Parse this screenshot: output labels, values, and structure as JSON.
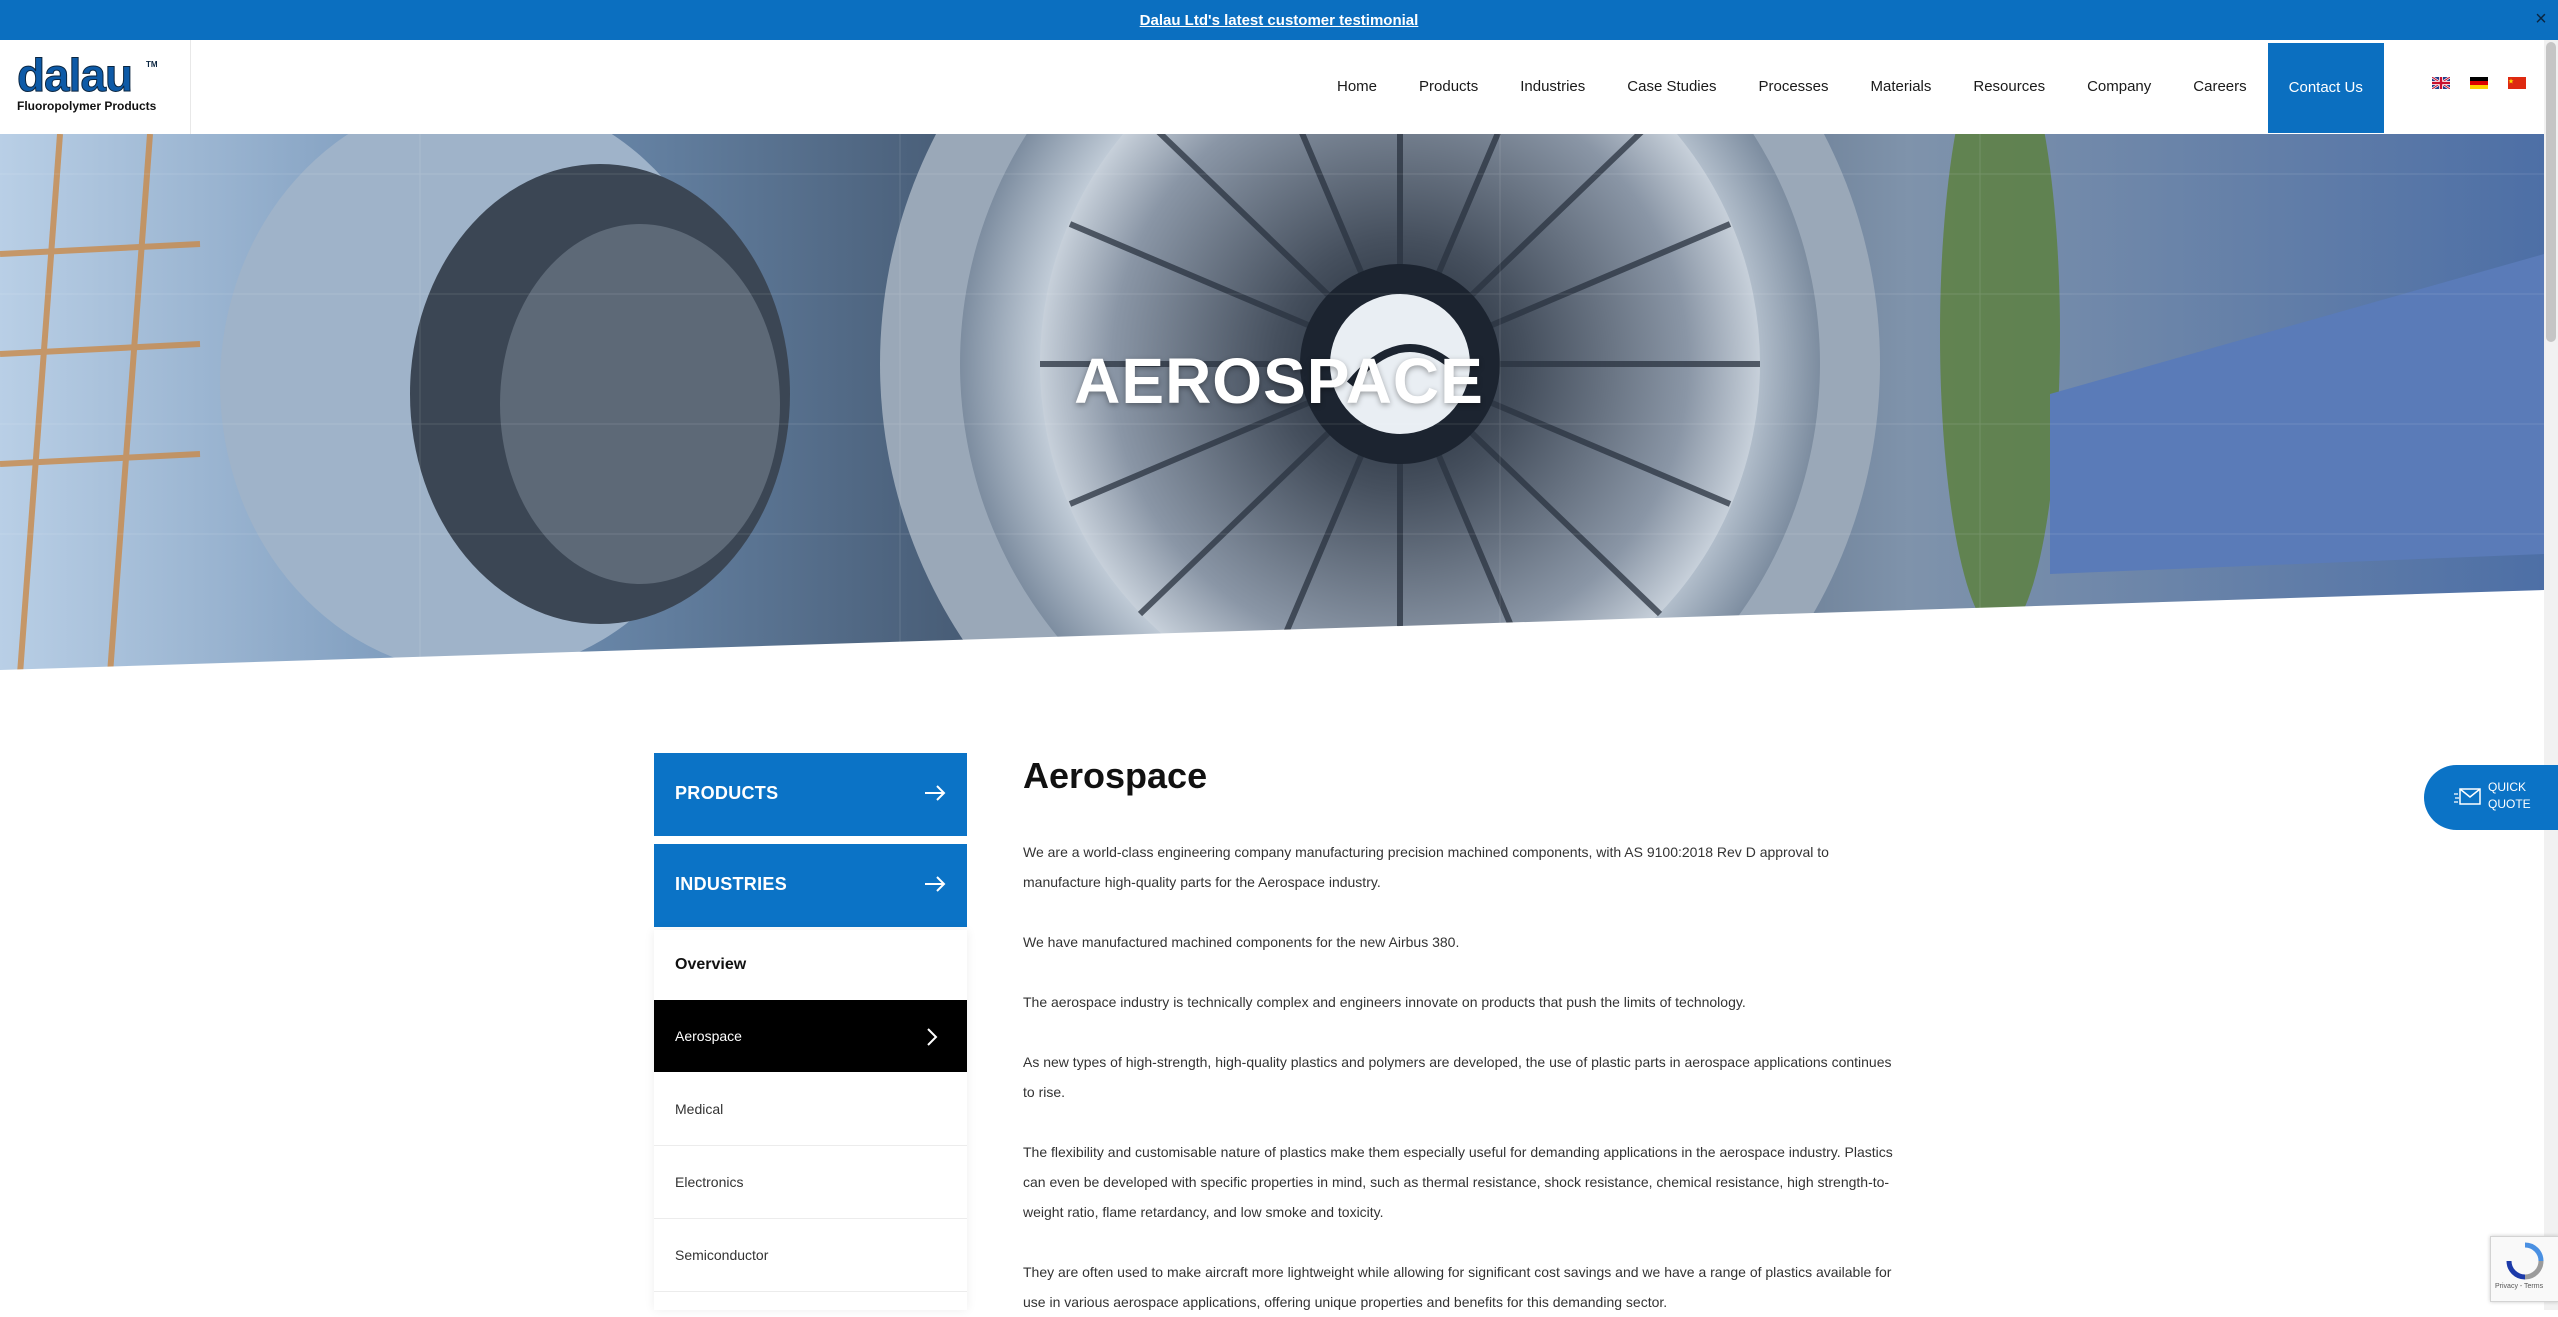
{
  "announcement": {
    "link_text": "Dalau Ltd's latest customer testimonial",
    "close": "×"
  },
  "logo": {
    "wordmark": "dalau",
    "tm": "TM",
    "subtitle": "Fluoropolymer Products"
  },
  "nav": {
    "items": [
      "Home",
      "Products",
      "Industries",
      "Case Studies",
      "Processes",
      "Materials",
      "Resources",
      "Company",
      "Careers"
    ],
    "contact": "Contact Us",
    "flags": [
      "uk-flag-icon",
      "germany-flag-icon",
      "china-flag-icon"
    ]
  },
  "hero": {
    "title": "AEROSPACE"
  },
  "sidebar": {
    "products": "PRODUCTS",
    "industries": "INDUSTRIES",
    "overview": "Overview",
    "items": [
      "Aerospace",
      "Medical",
      "Electronics",
      "Semiconductor"
    ],
    "active": "Aerospace"
  },
  "main": {
    "heading": "Aerospace",
    "paragraphs": [
      "We are a world-class engineering company manufacturing precision machined components, with AS 9100:2018 Rev D approval to manufacture high-quality parts for the Aerospace industry.",
      " We have manufactured machined components for the new Airbus 380.",
      "The aerospace industry is technically complex and engineers innovate on products that push the limits of technology.",
      "As new types of high-strength, high-quality plastics and polymers are developed, the use of plastic parts in aerospace applications continues to rise.",
      "The flexibility and customisable nature of plastics make them especially useful for demanding applications in the aerospace industry. Plastics can even be developed with specific properties in mind, such as thermal resistance, shock resistance, chemical resistance, high strength-to-weight ratio, flame retardancy, and low smoke and toxicity.",
      "They are often used to make aircraft more lightweight while allowing for significant cost savings and we have a range of plastics available for use in various aerospace applications, offering unique properties and benefits for this demanding sector."
    ]
  },
  "quick_quote": {
    "line1": "QUICK",
    "line2": "QUOTE"
  },
  "recaptcha": {
    "footer": "Privacy - Terms"
  },
  "colors": {
    "brand_blue": "#0b6fc0",
    "active_black": "#000000"
  }
}
